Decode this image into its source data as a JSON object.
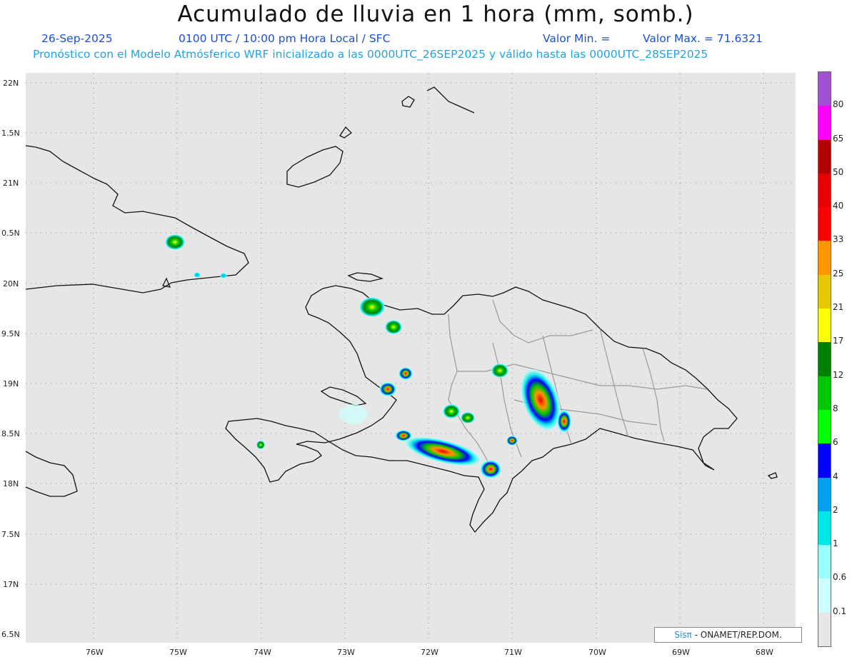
{
  "title": "Acumulado de lluvia en 1 hora (mm, somb.)",
  "subtitle": {
    "date": "26-Sep-2025",
    "time": "0100 UTC / 10:00 pm Hora Local / SFC",
    "min_label": "Valor Min. =",
    "max_label": "Valor Max. = 71.6321",
    "model": "Pronóstico con el Modelo Atmósferico WRF inicializado a las 0000UTC_26SEP2025 y válido hasta las  0000UTC_28SEP2025"
  },
  "axes": {
    "lat_labels": [
      "22N",
      "1.5N",
      "21N",
      "0.5N",
      "20N",
      "9.5N",
      "19N",
      "8.5N",
      "18N",
      "7.5N",
      "17N",
      "6.5N"
    ],
    "lon_labels": [
      "76W",
      "75W",
      "74W",
      "73W",
      "72W",
      "71W",
      "70W",
      "69W",
      "68W"
    ]
  },
  "legend": {
    "levels": [
      "0.1",
      "0.6",
      "1",
      "2",
      "4",
      "6",
      "8",
      "12",
      "17",
      "21",
      "25",
      "33",
      "40",
      "50",
      "65",
      "80"
    ],
    "colors": [
      "#e6e6e6",
      "#ccffff",
      "#99ffff",
      "#00e6e6",
      "#00a0f0",
      "#0000ff",
      "#00ff00",
      "#00c800",
      "#008000",
      "#ffff00",
      "#e6c800",
      "#ff9600",
      "#ff0000",
      "#e60000",
      "#b40000",
      "#ff00ff",
      "#a050d0"
    ]
  },
  "credit": {
    "brand": "Sisπ",
    "text": "- ONAMET/REP.DOM."
  }
}
